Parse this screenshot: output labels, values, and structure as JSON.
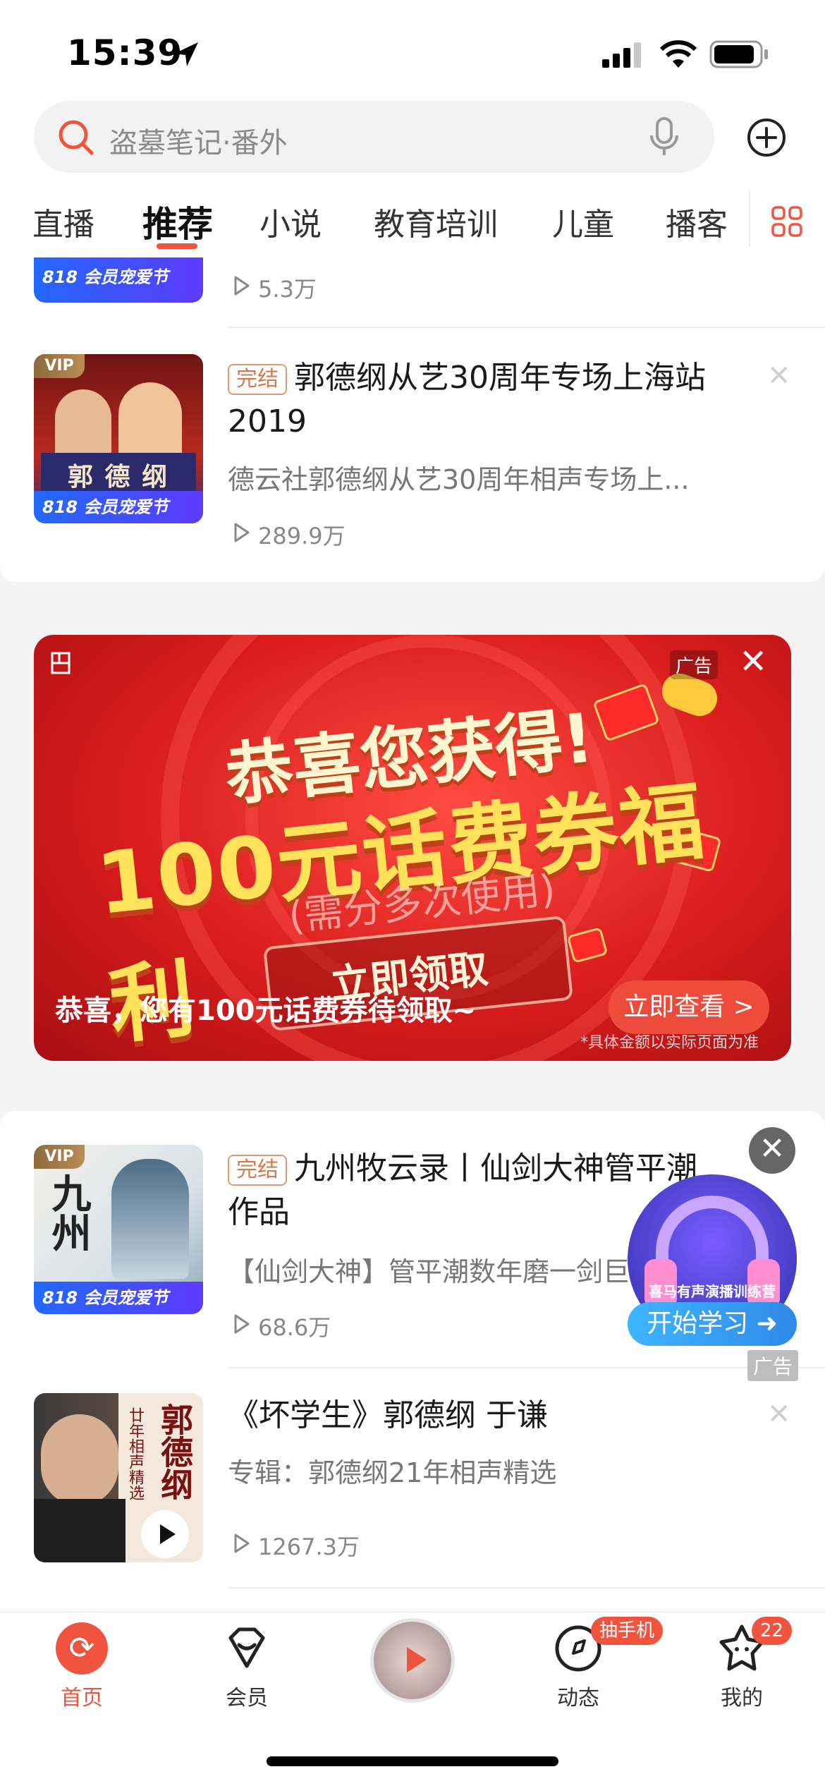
{
  "status_bar": {
    "time": "15:39"
  },
  "search": {
    "placeholder": "盗墓笔记·番外"
  },
  "tabs": [
    {
      "label": "直播"
    },
    {
      "label": "推荐",
      "active": true
    },
    {
      "label": "小说"
    },
    {
      "label": "教育培训"
    },
    {
      "label": "儿童"
    },
    {
      "label": "播客"
    }
  ],
  "badges": {
    "vip": "VIP",
    "member_818": "818 会员宠爱节"
  },
  "items": [
    {
      "plays": "5.3万"
    },
    {
      "tag": "完结",
      "title": "郭德纲从艺30周年专场上海站2019",
      "title_line1": "郭德纲从艺30周年专场上海站",
      "title_line2": "2019",
      "subtitle": "德云社郭德纲从艺30周年相声专场上...",
      "plays": "289.9万",
      "thumb_text": "郭 德 纲"
    },
    {
      "tag": "完结",
      "title_line1": "九州牧云录丨仙剑大神管平潮",
      "title_line2": "作品",
      "subtitle": "【仙剑大神】管平潮数年磨一剑巨",
      "plays": "68.6万",
      "thumb_text": "九州"
    },
    {
      "title": "《坏学生》郭德纲 于谦",
      "subtitle": "专辑：郭德纲21年相声精选",
      "plays": "1267.3万",
      "thumb_text": "郭德纲",
      "thumb_sub": "廿年相声精选"
    }
  ],
  "ad_banner": {
    "label": "广告",
    "headline1": "恭喜您获得!",
    "headline2": "100元话费券福利",
    "sub": "(需分多次使用)",
    "button": "立即领取",
    "caption": "恭喜，您有100元话费券待领取~",
    "cta": "立即查看 >",
    "fineprint": "*具体金额以实际页面为准"
  },
  "floating_ad": {
    "brand": "喜马有声演播训练营",
    "button": "开始学习",
    "label": "广告"
  },
  "bottom_nav": [
    {
      "label": "首页",
      "active": true
    },
    {
      "label": "会员"
    },
    {
      "label": ""
    },
    {
      "label": "动态",
      "badge": "抽手机"
    },
    {
      "label": "我的",
      "badge": "22"
    }
  ],
  "colors": {
    "accent": "#f0543f",
    "ad_red": "#d81c1c",
    "vip_gold": "#b98d55",
    "member_blue": "#2268ff"
  }
}
